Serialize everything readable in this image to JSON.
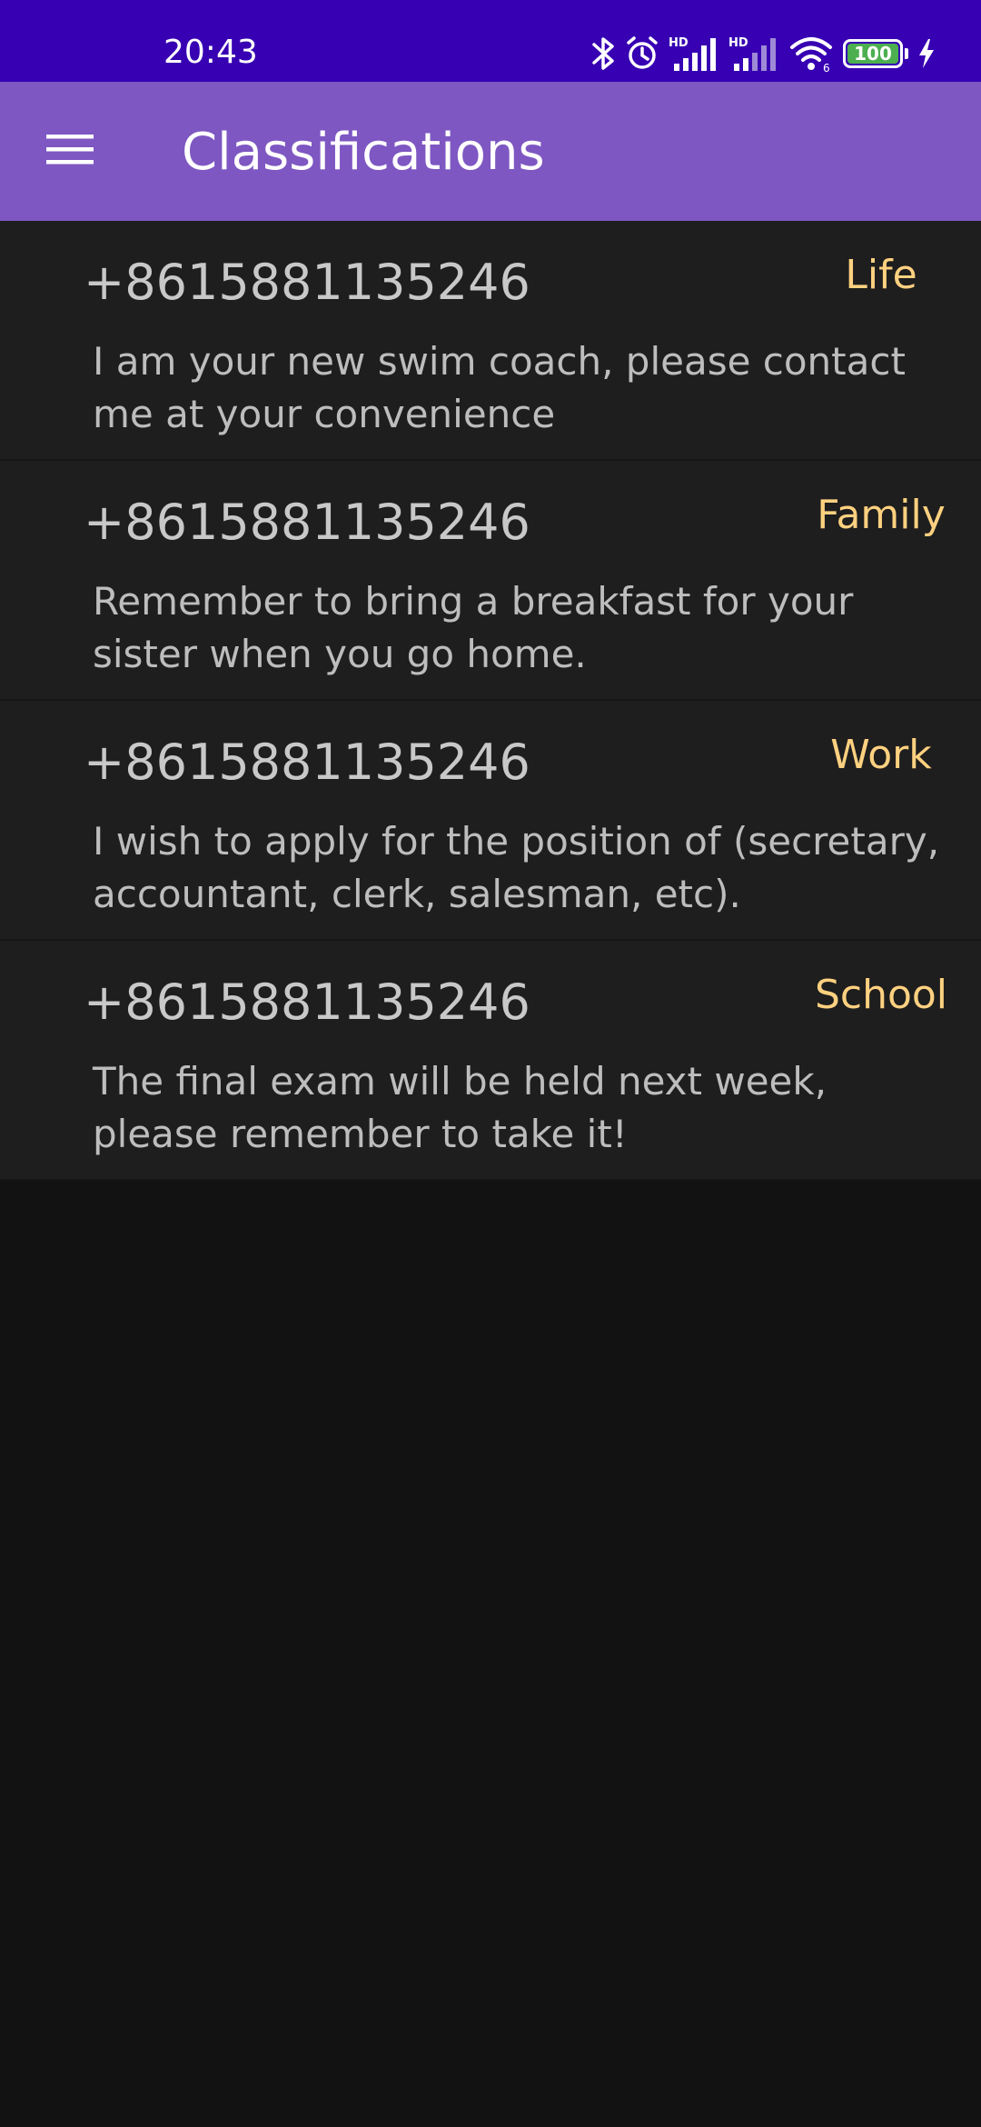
{
  "status_bar": {
    "time": "20:43",
    "battery_level": "100",
    "icons": [
      "bluetooth-icon",
      "alarm-icon",
      "signal-hd-icon",
      "signal-hd-icon",
      "wifi-icon",
      "battery-icon",
      "charging-icon"
    ]
  },
  "app_bar": {
    "title": "Classifications",
    "menu_icon": "hamburger-menu-icon",
    "background": "#7e57c2"
  },
  "colors": {
    "status_bar": "#3700b3",
    "category_text": "#ffd180",
    "item_background": "#1e1e1e",
    "screen_background": "#121212",
    "battery_fill": "#4caf50"
  },
  "messages": [
    {
      "sender": "+8615881135246",
      "category": "Life",
      "body": "I am your new swim coach, please contact me at your convenience"
    },
    {
      "sender": "+8615881135246",
      "category": "Family",
      "body": "Remember to bring a breakfast for your sister when you go home."
    },
    {
      "sender": "+8615881135246",
      "category": "Work",
      "body": "I wish to apply for the position of (secretary, accountant, clerk, salesman, etc)."
    },
    {
      "sender": "+8615881135246",
      "category": "School",
      "body": "The final exam will be held next week, please remember to take it!"
    }
  ]
}
